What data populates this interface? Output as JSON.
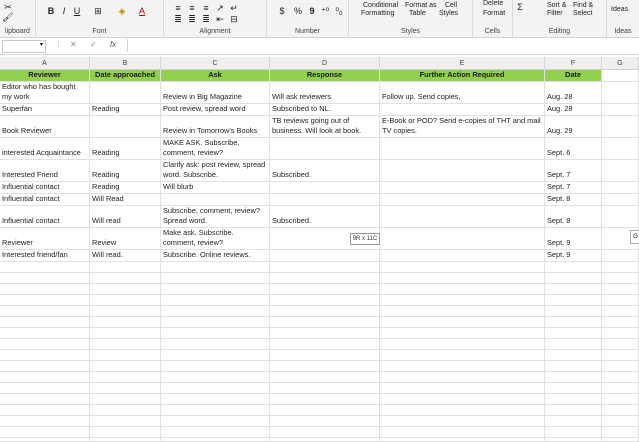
{
  "ribbon": {
    "groups": [
      {
        "label": "lipboard"
      },
      {
        "label": "Font"
      },
      {
        "label": "Alignment"
      },
      {
        "label": "Number"
      },
      {
        "label": "Styles"
      },
      {
        "label": "Cells"
      },
      {
        "label": "Editing"
      },
      {
        "label": "Ideas"
      }
    ],
    "font_bold": "B",
    "font_italic": "I",
    "font_underline": "U",
    "font_color": "A",
    "number_currency": "$",
    "number_percent": "%",
    "number_comma": "9",
    "cond_format_l1": "Conditional",
    "cond_format_l2": "Formatting",
    "format_table_l1": "Format as",
    "format_table_l2": "Table",
    "cell_styles_l1": "Cell",
    "cell_styles_l2": "Styles",
    "cells_delete": "Delete",
    "cells_format": "Format",
    "sort_l1": "Sort &",
    "sort_l2": "Filter",
    "find_l1": "Find &",
    "find_l2": "Select",
    "ideas": "Ideas"
  },
  "formula_bar": {
    "cancel": "✕",
    "confirm": "✓",
    "fx": "fx",
    "value": ""
  },
  "columns": [
    "A",
    "B",
    "C",
    "D",
    "E",
    "F",
    "G"
  ],
  "table": {
    "headers": [
      "Reviewer",
      "Date approached",
      "Ask",
      "Response",
      "Further Action Required",
      "Date"
    ],
    "rows": [
      [
        "Editor who has bought my work",
        "",
        "Review in Big Magazine",
        "Will ask reviewers",
        "Follow up. Send copies,",
        "Aug. 28"
      ],
      [
        "Superfan",
        "Reading",
        "Post review, spread word",
        "Subscribed to NL.",
        "",
        "Aug. 28"
      ],
      [
        "Book Reviewer",
        "",
        "Review in Tomorrow's Books",
        "TB reviews going out of business. Will look at book.",
        "E-Book or POD? Send e-copies of THT and mail TV copies.",
        "Aug. 29"
      ],
      [
        "interested Acquaintance",
        "Reading",
        "MAKE ASK. Subscribe, comment, review?",
        "",
        "",
        "Sept. 6"
      ],
      [
        "Interested Friend",
        "Reading",
        "Clarify ask: post review, spread word. Subscribe.",
        "Subscribed.",
        "",
        "Sept. 7"
      ],
      [
        "Influential contact",
        "Reading",
        "Will blurb",
        "",
        "",
        "Sept. 7"
      ],
      [
        "Influential contact",
        "Will Read",
        "",
        "",
        "",
        "Sept. 8"
      ],
      [
        "Influential contact",
        "Will read",
        "Subscribe, comment, review? Spread word.",
        "Subscribed.",
        "",
        "Sept. 8"
      ],
      [
        "Reviewer",
        "Review",
        "Make ask. Subscribe. comment, review?",
        "",
        "",
        "Sept. 9"
      ],
      [
        "Interested friend/fan",
        "Will read.",
        "Subscribe. Online reviews.",
        "",
        "",
        "Sept. 9"
      ]
    ]
  },
  "selection_tooltip": "9R x 11C",
  "scroll_marker": "G",
  "colors": {
    "header_fill": "#92d050",
    "ribbon_bg": "#f3f3f3",
    "font_color_accent": "#c00000",
    "gridline": "#e1e1e1"
  }
}
